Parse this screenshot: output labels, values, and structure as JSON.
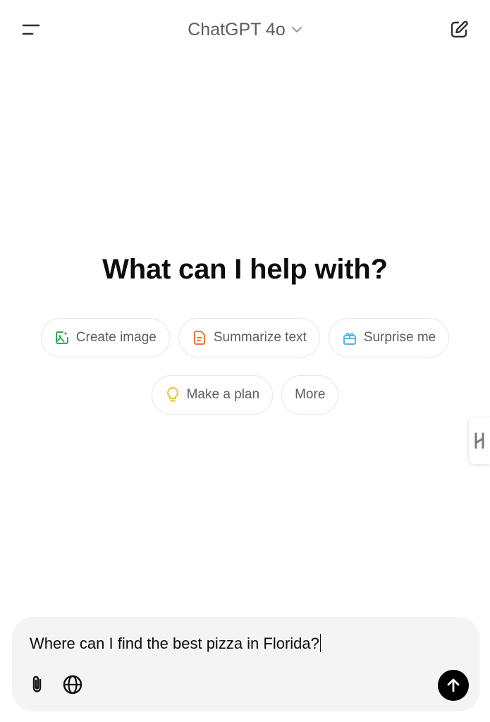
{
  "header": {
    "model_name": "ChatGPT 4o",
    "menu_icon": "hamburger-icon",
    "dropdown_icon": "chevron-down-icon",
    "new_chat_icon": "pencil-square-icon"
  },
  "main": {
    "title": "What can I help with?",
    "suggestions": [
      {
        "label": "Create image",
        "icon": "image-icon",
        "color": "#34a853"
      },
      {
        "label": "Summarize text",
        "icon": "document-icon",
        "color": "#ea7a2e"
      },
      {
        "label": "Surprise me",
        "icon": "gift-icon",
        "color": "#4fb7e8"
      },
      {
        "label": "Make a plan",
        "icon": "lightbulb-icon",
        "color": "#e8c236"
      },
      {
        "label": "More",
        "icon": "",
        "color": ""
      }
    ]
  },
  "composer": {
    "text": "Where can I find the best pizza in Florida?",
    "attach_icon": "paperclip-icon",
    "web_icon": "globe-icon",
    "send_icon": "arrow-up-icon"
  },
  "side_handle": {
    "icon": "extension-handle-icon"
  }
}
